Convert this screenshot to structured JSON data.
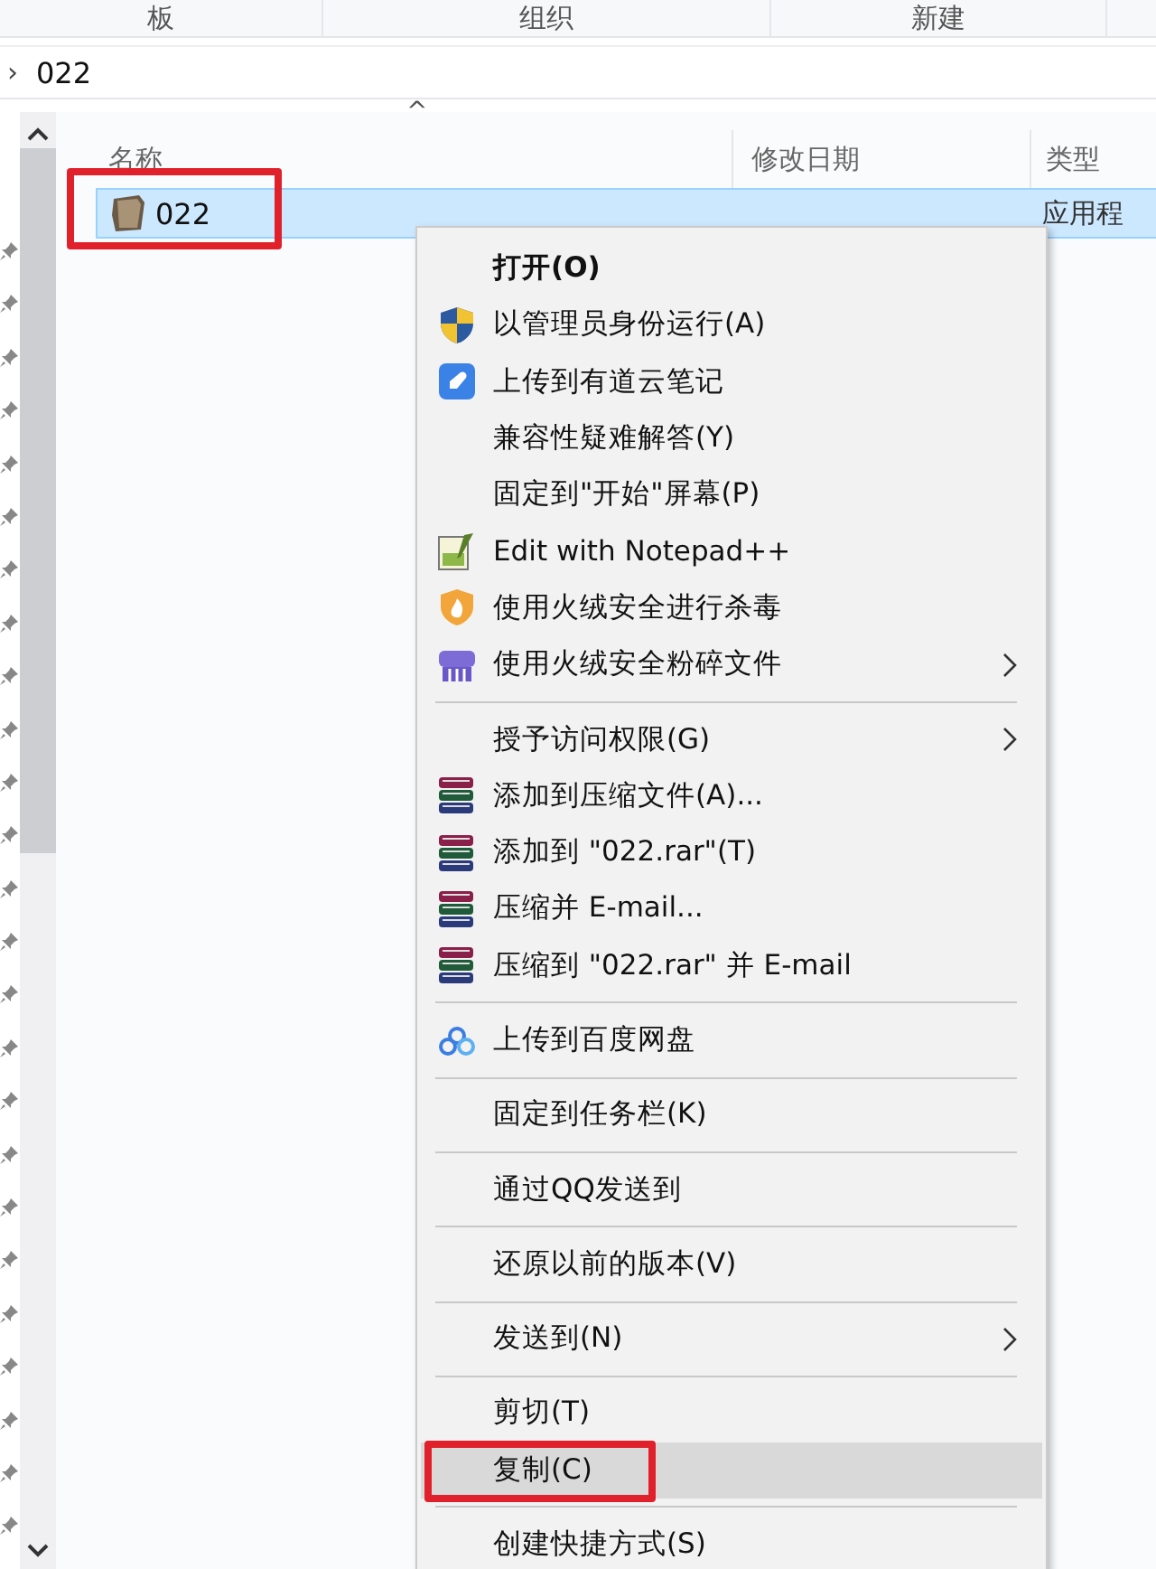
{
  "ribbon": {
    "groups": [
      "板",
      "组织",
      "新建"
    ]
  },
  "address_bar": {
    "separator": "›",
    "path": "022"
  },
  "file_list": {
    "sort_indicator": "^",
    "columns": [
      "名称",
      "修改日期",
      "类型"
    ],
    "rows": [
      {
        "name": "022",
        "type": "应用程",
        "selected": true,
        "marked": true
      }
    ]
  },
  "context_menu": {
    "items": [
      {
        "kind": "item",
        "label": "打开(O)",
        "bold": true,
        "submenu": false,
        "highlighted": false,
        "marked": false
      },
      {
        "kind": "item",
        "label": "以管理员身份运行(A)",
        "bold": false,
        "submenu": false,
        "highlighted": false,
        "marked": false
      },
      {
        "kind": "item",
        "label": "上传到有道云笔记",
        "bold": false,
        "submenu": false,
        "highlighted": false,
        "marked": false
      },
      {
        "kind": "item",
        "label": "兼容性疑难解答(Y)",
        "bold": false,
        "submenu": false,
        "highlighted": false,
        "marked": false
      },
      {
        "kind": "item",
        "label": "固定到\"开始\"屏幕(P)",
        "bold": false,
        "submenu": false,
        "highlighted": false,
        "marked": false
      },
      {
        "kind": "item",
        "label": "Edit with Notepad++",
        "bold": false,
        "submenu": false,
        "highlighted": false,
        "marked": false
      },
      {
        "kind": "item",
        "label": "使用火绒安全进行杀毒",
        "bold": false,
        "submenu": false,
        "highlighted": false,
        "marked": false
      },
      {
        "kind": "item",
        "label": "使用火绒安全粉碎文件",
        "bold": false,
        "submenu": true,
        "highlighted": false,
        "marked": false
      },
      {
        "kind": "separator"
      },
      {
        "kind": "item",
        "label": "授予访问权限(G)",
        "bold": false,
        "submenu": true,
        "highlighted": false,
        "marked": false
      },
      {
        "kind": "item",
        "label": "添加到压缩文件(A)...",
        "bold": false,
        "submenu": false,
        "highlighted": false,
        "marked": false
      },
      {
        "kind": "item",
        "label": "添加到 \"022.rar\"(T)",
        "bold": false,
        "submenu": false,
        "highlighted": false,
        "marked": false
      },
      {
        "kind": "item",
        "label": "压缩并 E-mail...",
        "bold": false,
        "submenu": false,
        "highlighted": false,
        "marked": false
      },
      {
        "kind": "item",
        "label": "压缩到 \"022.rar\" 并 E-mail",
        "bold": false,
        "submenu": false,
        "highlighted": false,
        "marked": false
      },
      {
        "kind": "separator"
      },
      {
        "kind": "item",
        "label": "上传到百度网盘",
        "bold": false,
        "submenu": false,
        "highlighted": false,
        "marked": false
      },
      {
        "kind": "separator"
      },
      {
        "kind": "item",
        "label": "固定到任务栏(K)",
        "bold": false,
        "submenu": false,
        "highlighted": false,
        "marked": false
      },
      {
        "kind": "separator"
      },
      {
        "kind": "item",
        "label": "通过QQ发送到",
        "bold": false,
        "submenu": false,
        "highlighted": false,
        "marked": false
      },
      {
        "kind": "separator"
      },
      {
        "kind": "item",
        "label": "还原以前的版本(V)",
        "bold": false,
        "submenu": false,
        "highlighted": false,
        "marked": false
      },
      {
        "kind": "separator"
      },
      {
        "kind": "item",
        "label": "发送到(N)",
        "bold": false,
        "submenu": true,
        "highlighted": false,
        "marked": false
      },
      {
        "kind": "separator"
      },
      {
        "kind": "item",
        "label": "剪切(T)",
        "bold": false,
        "submenu": false,
        "highlighted": false,
        "marked": false
      },
      {
        "kind": "item",
        "label": "复制(C)",
        "bold": false,
        "submenu": false,
        "highlighted": true,
        "marked": true
      },
      {
        "kind": "separator"
      },
      {
        "kind": "item",
        "label": "创建快捷方式(S)",
        "bold": false,
        "submenu": false,
        "highlighted": false,
        "marked": false
      }
    ]
  }
}
